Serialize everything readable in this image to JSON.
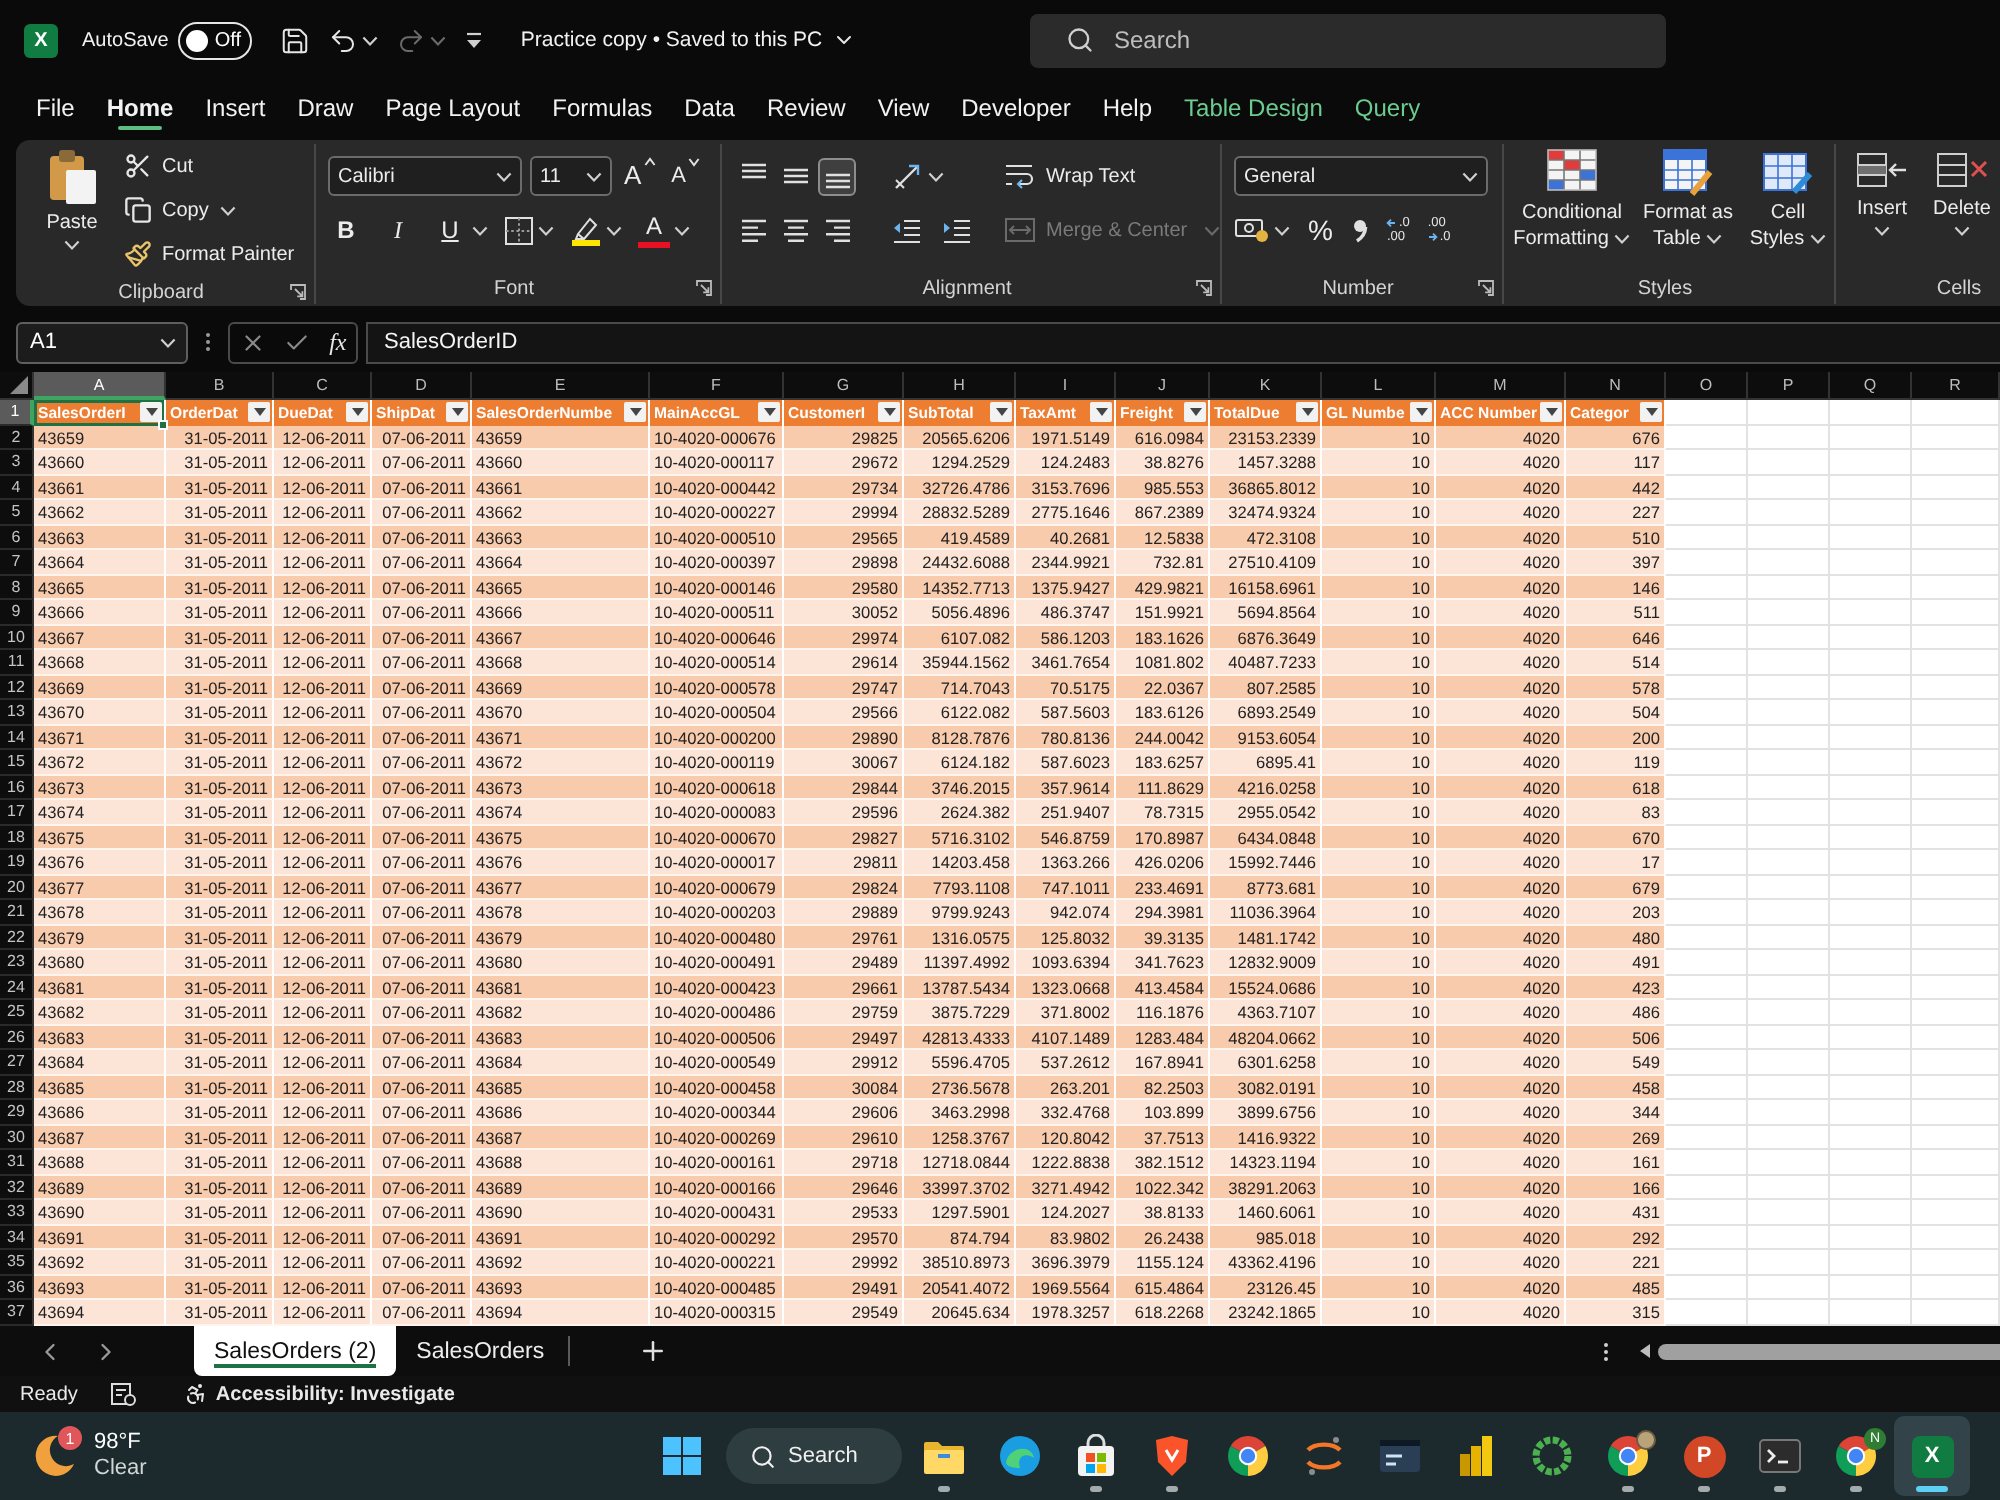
{
  "title_bar": {
    "app_letter": "X",
    "autosave_label": "AutoSave",
    "autosave": {
      "on": false,
      "label": "Off"
    },
    "document_title": "Practice copy • Saved to this PC",
    "search": {
      "placeholder": "Search"
    }
  },
  "menu_tabs": [
    {
      "label": "File",
      "kind": "standard",
      "selected": false
    },
    {
      "label": "Home",
      "kind": "standard",
      "selected": true
    },
    {
      "label": "Insert",
      "kind": "standard",
      "selected": false
    },
    {
      "label": "Draw",
      "kind": "standard",
      "selected": false
    },
    {
      "label": "Page Layout",
      "kind": "standard",
      "selected": false
    },
    {
      "label": "Formulas",
      "kind": "standard",
      "selected": false
    },
    {
      "label": "Data",
      "kind": "standard",
      "selected": false
    },
    {
      "label": "Review",
      "kind": "standard",
      "selected": false
    },
    {
      "label": "View",
      "kind": "standard",
      "selected": false
    },
    {
      "label": "Developer",
      "kind": "standard",
      "selected": false
    },
    {
      "label": "Help",
      "kind": "standard",
      "selected": false
    },
    {
      "label": "Table Design",
      "kind": "contextual",
      "selected": false
    },
    {
      "label": "Query",
      "kind": "contextual",
      "selected": false
    }
  ],
  "ribbon": {
    "clipboard": {
      "paste": "Paste",
      "cut": "Cut",
      "copy": "Copy",
      "format_painter": "Format Painter",
      "label": "Clipboard"
    },
    "font": {
      "name": "Calibri",
      "size": "11",
      "grow_glyph": "A",
      "shrink_glyph": "A",
      "style_buttons": [
        {
          "kind": "bold",
          "glyph": "B"
        },
        {
          "kind": "italic",
          "glyph": "I"
        },
        {
          "kind": "underline",
          "glyph": "U"
        }
      ],
      "color_glyph": "A",
      "label": "Font"
    },
    "alignment": {
      "vertical": [
        {
          "kind": "top",
          "selected": false
        },
        {
          "kind": "middle",
          "selected": false
        },
        {
          "kind": "bottom",
          "selected": true
        }
      ],
      "horizontal": [
        {
          "kind": "left",
          "selected": false
        },
        {
          "kind": "center",
          "selected": false
        },
        {
          "kind": "right",
          "selected": false
        }
      ],
      "wrap_text": "Wrap Text",
      "merge": {
        "label": "Merge & Center",
        "disabled": true
      },
      "label": "Alignment"
    },
    "number": {
      "format": "General",
      "percent_glyph": "%",
      "decimal_buttons": [
        {
          "kind": "increase",
          "lines": [
            ".0",
            ".00"
          ]
        },
        {
          "kind": "decrease",
          "lines": [
            ".00",
            ".0"
          ]
        }
      ],
      "label": "Number"
    },
    "styles": {
      "buttons": [
        {
          "kind": "conditional",
          "lines": [
            "Conditional",
            "Formatting"
          ]
        },
        {
          "kind": "table",
          "lines": [
            "Format as",
            "Table"
          ]
        },
        {
          "kind": "cell",
          "lines": [
            "Cell",
            "Styles"
          ]
        }
      ],
      "label": "Styles"
    },
    "cells": {
      "buttons": [
        {
          "kind": "insert",
          "label": "Insert"
        },
        {
          "kind": "delete",
          "label": "Delete"
        }
      ],
      "label": "Cells"
    }
  },
  "formula_bar": {
    "name_box": "A1",
    "function_glyph": "fx",
    "formula": "SalesOrderID"
  },
  "sheet": {
    "column_letters": [
      {
        "label": "A",
        "selected": true
      },
      {
        "label": "B",
        "selected": false
      },
      {
        "label": "C",
        "selected": false
      },
      {
        "label": "D",
        "selected": false
      },
      {
        "label": "E",
        "selected": false
      },
      {
        "label": "F",
        "selected": false
      },
      {
        "label": "G",
        "selected": false
      },
      {
        "label": "H",
        "selected": false
      },
      {
        "label": "I",
        "selected": false
      },
      {
        "label": "J",
        "selected": false
      },
      {
        "label": "K",
        "selected": false
      },
      {
        "label": "L",
        "selected": false
      },
      {
        "label": "M",
        "selected": false
      },
      {
        "label": "N",
        "selected": false
      },
      {
        "label": "O",
        "selected": false
      },
      {
        "label": "P",
        "selected": false
      },
      {
        "label": "Q",
        "selected": false
      },
      {
        "label": "R",
        "selected": false
      }
    ],
    "row_numbers": [
      {
        "label": "1",
        "selected": true
      },
      {
        "label": "2",
        "selected": false
      },
      {
        "label": "3",
        "selected": false
      },
      {
        "label": "4",
        "selected": false
      },
      {
        "label": "5",
        "selected": false
      },
      {
        "label": "6",
        "selected": false
      },
      {
        "label": "7",
        "selected": false
      },
      {
        "label": "8",
        "selected": false
      },
      {
        "label": "9",
        "selected": false
      },
      {
        "label": "10",
        "selected": false
      },
      {
        "label": "11",
        "selected": false
      },
      {
        "label": "12",
        "selected": false
      },
      {
        "label": "13",
        "selected": false
      },
      {
        "label": "14",
        "selected": false
      },
      {
        "label": "15",
        "selected": false
      },
      {
        "label": "16",
        "selected": false
      },
      {
        "label": "17",
        "selected": false
      },
      {
        "label": "18",
        "selected": false
      },
      {
        "label": "19",
        "selected": false
      },
      {
        "label": "20",
        "selected": false
      },
      {
        "label": "21",
        "selected": false
      },
      {
        "label": "22",
        "selected": false
      },
      {
        "label": "23",
        "selected": false
      },
      {
        "label": "24",
        "selected": false
      },
      {
        "label": "25",
        "selected": false
      },
      {
        "label": "26",
        "selected": false
      },
      {
        "label": "27",
        "selected": false
      },
      {
        "label": "28",
        "selected": false
      },
      {
        "label": "29",
        "selected": false
      },
      {
        "label": "30",
        "selected": false
      },
      {
        "label": "31",
        "selected": false
      },
      {
        "label": "32",
        "selected": false
      },
      {
        "label": "33",
        "selected": false
      },
      {
        "label": "34",
        "selected": false
      },
      {
        "label": "35",
        "selected": false
      },
      {
        "label": "36",
        "selected": false
      },
      {
        "label": "37",
        "selected": false
      }
    ],
    "table": {
      "columns": [
        {
          "label": "SalesOrderI",
          "kind": "text"
        },
        {
          "label": "OrderDat",
          "kind": "date"
        },
        {
          "label": "DueDat",
          "kind": "date"
        },
        {
          "label": "ShipDat",
          "kind": "date"
        },
        {
          "label": "SalesOrderNumbe",
          "kind": "text"
        },
        {
          "label": "MainAccGL",
          "kind": "text"
        },
        {
          "label": "CustomerI",
          "kind": "number"
        },
        {
          "label": "SubTotal",
          "kind": "number"
        },
        {
          "label": "TaxAmt",
          "kind": "number"
        },
        {
          "label": "Freight",
          "kind": "number"
        },
        {
          "label": "TotalDue",
          "kind": "number"
        },
        {
          "label": "GL Numbe",
          "kind": "number"
        },
        {
          "label": "ACC Number",
          "kind": "number"
        },
        {
          "label": "Categor",
          "kind": "number"
        }
      ],
      "rows": [
        [
          "43659",
          "31-05-2011",
          "12-06-2011",
          "07-06-2011",
          "43659",
          "10-4020-000676",
          "29825",
          "20565.6206",
          "1971.5149",
          "616.0984",
          "23153.2339",
          "10",
          "4020",
          "676"
        ],
        [
          "43660",
          "31-05-2011",
          "12-06-2011",
          "07-06-2011",
          "43660",
          "10-4020-000117",
          "29672",
          "1294.2529",
          "124.2483",
          "38.8276",
          "1457.3288",
          "10",
          "4020",
          "117"
        ],
        [
          "43661",
          "31-05-2011",
          "12-06-2011",
          "07-06-2011",
          "43661",
          "10-4020-000442",
          "29734",
          "32726.4786",
          "3153.7696",
          "985.553",
          "36865.8012",
          "10",
          "4020",
          "442"
        ],
        [
          "43662",
          "31-05-2011",
          "12-06-2011",
          "07-06-2011",
          "43662",
          "10-4020-000227",
          "29994",
          "28832.5289",
          "2775.1646",
          "867.2389",
          "32474.9324",
          "10",
          "4020",
          "227"
        ],
        [
          "43663",
          "31-05-2011",
          "12-06-2011",
          "07-06-2011",
          "43663",
          "10-4020-000510",
          "29565",
          "419.4589",
          "40.2681",
          "12.5838",
          "472.3108",
          "10",
          "4020",
          "510"
        ],
        [
          "43664",
          "31-05-2011",
          "12-06-2011",
          "07-06-2011",
          "43664",
          "10-4020-000397",
          "29898",
          "24432.6088",
          "2344.9921",
          "732.81",
          "27510.4109",
          "10",
          "4020",
          "397"
        ],
        [
          "43665",
          "31-05-2011",
          "12-06-2011",
          "07-06-2011",
          "43665",
          "10-4020-000146",
          "29580",
          "14352.7713",
          "1375.9427",
          "429.9821",
          "16158.6961",
          "10",
          "4020",
          "146"
        ],
        [
          "43666",
          "31-05-2011",
          "12-06-2011",
          "07-06-2011",
          "43666",
          "10-4020-000511",
          "30052",
          "5056.4896",
          "486.3747",
          "151.9921",
          "5694.8564",
          "10",
          "4020",
          "511"
        ],
        [
          "43667",
          "31-05-2011",
          "12-06-2011",
          "07-06-2011",
          "43667",
          "10-4020-000646",
          "29974",
          "6107.082",
          "586.1203",
          "183.1626",
          "6876.3649",
          "10",
          "4020",
          "646"
        ],
        [
          "43668",
          "31-05-2011",
          "12-06-2011",
          "07-06-2011",
          "43668",
          "10-4020-000514",
          "29614",
          "35944.1562",
          "3461.7654",
          "1081.802",
          "40487.7233",
          "10",
          "4020",
          "514"
        ],
        [
          "43669",
          "31-05-2011",
          "12-06-2011",
          "07-06-2011",
          "43669",
          "10-4020-000578",
          "29747",
          "714.7043",
          "70.5175",
          "22.0367",
          "807.2585",
          "10",
          "4020",
          "578"
        ],
        [
          "43670",
          "31-05-2011",
          "12-06-2011",
          "07-06-2011",
          "43670",
          "10-4020-000504",
          "29566",
          "6122.082",
          "587.5603",
          "183.6126",
          "6893.2549",
          "10",
          "4020",
          "504"
        ],
        [
          "43671",
          "31-05-2011",
          "12-06-2011",
          "07-06-2011",
          "43671",
          "10-4020-000200",
          "29890",
          "8128.7876",
          "780.8136",
          "244.0042",
          "9153.6054",
          "10",
          "4020",
          "200"
        ],
        [
          "43672",
          "31-05-2011",
          "12-06-2011",
          "07-06-2011",
          "43672",
          "10-4020-000119",
          "30067",
          "6124.182",
          "587.6023",
          "183.6257",
          "6895.41",
          "10",
          "4020",
          "119"
        ],
        [
          "43673",
          "31-05-2011",
          "12-06-2011",
          "07-06-2011",
          "43673",
          "10-4020-000618",
          "29844",
          "3746.2015",
          "357.9614",
          "111.8629",
          "4216.0258",
          "10",
          "4020",
          "618"
        ],
        [
          "43674",
          "31-05-2011",
          "12-06-2011",
          "07-06-2011",
          "43674",
          "10-4020-000083",
          "29596",
          "2624.382",
          "251.9407",
          "78.7315",
          "2955.0542",
          "10",
          "4020",
          "83"
        ],
        [
          "43675",
          "31-05-2011",
          "12-06-2011",
          "07-06-2011",
          "43675",
          "10-4020-000670",
          "29827",
          "5716.3102",
          "546.8759",
          "170.8987",
          "6434.0848",
          "10",
          "4020",
          "670"
        ],
        [
          "43676",
          "31-05-2011",
          "12-06-2011",
          "07-06-2011",
          "43676",
          "10-4020-000017",
          "29811",
          "14203.458",
          "1363.266",
          "426.0206",
          "15992.7446",
          "10",
          "4020",
          "17"
        ],
        [
          "43677",
          "31-05-2011",
          "12-06-2011",
          "07-06-2011",
          "43677",
          "10-4020-000679",
          "29824",
          "7793.1108",
          "747.1011",
          "233.4691",
          "8773.681",
          "10",
          "4020",
          "679"
        ],
        [
          "43678",
          "31-05-2011",
          "12-06-2011",
          "07-06-2011",
          "43678",
          "10-4020-000203",
          "29889",
          "9799.9243",
          "942.074",
          "294.3981",
          "11036.3964",
          "10",
          "4020",
          "203"
        ],
        [
          "43679",
          "31-05-2011",
          "12-06-2011",
          "07-06-2011",
          "43679",
          "10-4020-000480",
          "29761",
          "1316.0575",
          "125.8032",
          "39.3135",
          "1481.1742",
          "10",
          "4020",
          "480"
        ],
        [
          "43680",
          "31-05-2011",
          "12-06-2011",
          "07-06-2011",
          "43680",
          "10-4020-000491",
          "29489",
          "11397.4992",
          "1093.6394",
          "341.7623",
          "12832.9009",
          "10",
          "4020",
          "491"
        ],
        [
          "43681",
          "31-05-2011",
          "12-06-2011",
          "07-06-2011",
          "43681",
          "10-4020-000423",
          "29661",
          "13787.5434",
          "1323.0668",
          "413.4584",
          "15524.0686",
          "10",
          "4020",
          "423"
        ],
        [
          "43682",
          "31-05-2011",
          "12-06-2011",
          "07-06-2011",
          "43682",
          "10-4020-000486",
          "29759",
          "3875.7229",
          "371.8002",
          "116.1876",
          "4363.7107",
          "10",
          "4020",
          "486"
        ],
        [
          "43683",
          "31-05-2011",
          "12-06-2011",
          "07-06-2011",
          "43683",
          "10-4020-000506",
          "29497",
          "42813.4333",
          "4107.1489",
          "1283.484",
          "48204.0662",
          "10",
          "4020",
          "506"
        ],
        [
          "43684",
          "31-05-2011",
          "12-06-2011",
          "07-06-2011",
          "43684",
          "10-4020-000549",
          "29912",
          "5596.4705",
          "537.2612",
          "167.8941",
          "6301.6258",
          "10",
          "4020",
          "549"
        ],
        [
          "43685",
          "31-05-2011",
          "12-06-2011",
          "07-06-2011",
          "43685",
          "10-4020-000458",
          "30084",
          "2736.5678",
          "263.201",
          "82.2503",
          "3082.0191",
          "10",
          "4020",
          "458"
        ],
        [
          "43686",
          "31-05-2011",
          "12-06-2011",
          "07-06-2011",
          "43686",
          "10-4020-000344",
          "29606",
          "3463.2998",
          "332.4768",
          "103.899",
          "3899.6756",
          "10",
          "4020",
          "344"
        ],
        [
          "43687",
          "31-05-2011",
          "12-06-2011",
          "07-06-2011",
          "43687",
          "10-4020-000269",
          "29610",
          "1258.3767",
          "120.8042",
          "37.7513",
          "1416.9322",
          "10",
          "4020",
          "269"
        ],
        [
          "43688",
          "31-05-2011",
          "12-06-2011",
          "07-06-2011",
          "43688",
          "10-4020-000161",
          "29718",
          "12718.0844",
          "1222.8838",
          "382.1512",
          "14323.1194",
          "10",
          "4020",
          "161"
        ],
        [
          "43689",
          "31-05-2011",
          "12-06-2011",
          "07-06-2011",
          "43689",
          "10-4020-000166",
          "29646",
          "33997.3702",
          "3271.4942",
          "1022.342",
          "38291.2063",
          "10",
          "4020",
          "166"
        ],
        [
          "43690",
          "31-05-2011",
          "12-06-2011",
          "07-06-2011",
          "43690",
          "10-4020-000431",
          "29533",
          "1297.5901",
          "124.2027",
          "38.8133",
          "1460.6061",
          "10",
          "4020",
          "431"
        ],
        [
          "43691",
          "31-05-2011",
          "12-06-2011",
          "07-06-2011",
          "43691",
          "10-4020-000292",
          "29570",
          "874.794",
          "83.9802",
          "26.2438",
          "985.018",
          "10",
          "4020",
          "292"
        ],
        [
          "43692",
          "31-05-2011",
          "12-06-2011",
          "07-06-2011",
          "43692",
          "10-4020-000221",
          "29992",
          "38510.8973",
          "3696.3979",
          "1155.124",
          "43362.4196",
          "10",
          "4020",
          "221"
        ],
        [
          "43693",
          "31-05-2011",
          "12-06-2011",
          "07-06-2011",
          "43693",
          "10-4020-000485",
          "29491",
          "20541.4072",
          "1969.5564",
          "615.4864",
          "23126.45",
          "10",
          "4020",
          "485"
        ],
        [
          "43694",
          "31-05-2011",
          "12-06-2011",
          "07-06-2011",
          "43694",
          "10-4020-000315",
          "29549",
          "20645.634",
          "1978.3257",
          "618.2268",
          "23242.1865",
          "10",
          "4020",
          "315"
        ]
      ]
    }
  },
  "sheet_tabs": {
    "tabs": [
      {
        "label": "SalesOrders (2)",
        "selected": true
      },
      {
        "label": "SalesOrders",
        "selected": false
      }
    ]
  },
  "status_bar": {
    "mode": "Ready",
    "accessibility": "Accessibility: Investigate"
  },
  "taskbar": {
    "weather": {
      "badge": "1",
      "temperature": "98°F",
      "condition": "Clear"
    },
    "search_label": "Search",
    "apps": [
      {
        "kind": "folder",
        "running": true,
        "selected": false
      },
      {
        "kind": "wave",
        "running": false,
        "selected": false
      },
      {
        "kind": "bag",
        "running": true,
        "selected": false
      },
      {
        "kind": "shield",
        "running": true,
        "selected": false
      },
      {
        "kind": "wheel",
        "running": false,
        "selected": false
      },
      {
        "kind": "arcs",
        "running": false,
        "selected": false
      },
      {
        "kind": "console",
        "running": false,
        "selected": false
      },
      {
        "kind": "bars",
        "running": false,
        "selected": false
      },
      {
        "kind": "ring",
        "running": false,
        "selected": false
      },
      {
        "kind": "wheel",
        "running": true,
        "selected": false,
        "badge": {
          "kind": "avatar"
        }
      },
      {
        "kind": "slides",
        "letter": "P",
        "running": true,
        "selected": false
      },
      {
        "kind": "terminal",
        "running": true,
        "selected": false
      },
      {
        "kind": "wheel",
        "running": true,
        "selected": false,
        "badge": {
          "kind": "letter",
          "text": "N"
        }
      },
      {
        "kind": "sheet",
        "letter": "X",
        "running": true,
        "selected": true
      }
    ]
  }
}
